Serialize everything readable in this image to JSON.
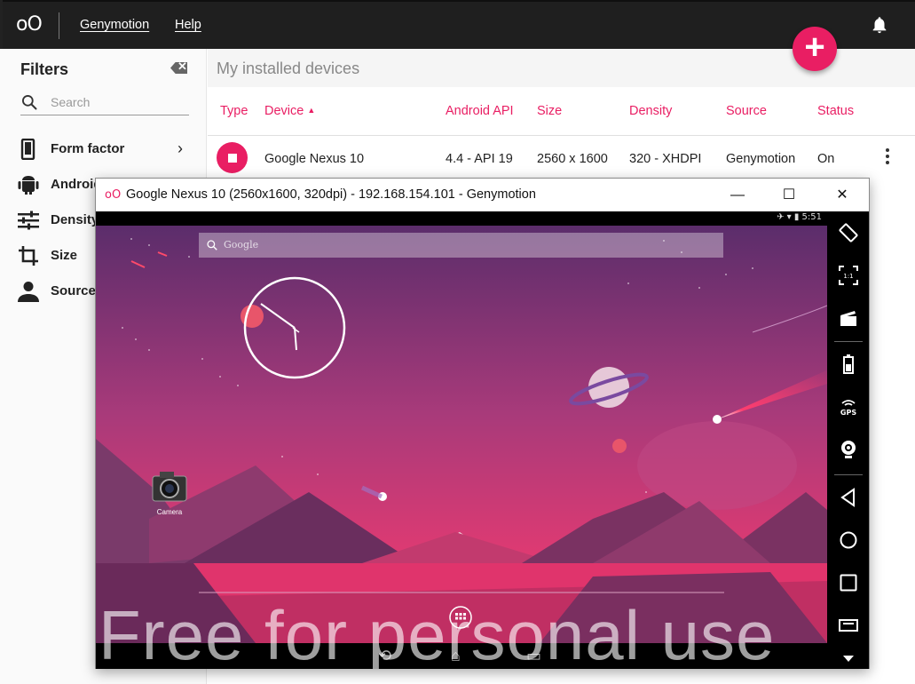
{
  "app": {
    "logo": "oO",
    "menu": [
      "Genymotion",
      "Help"
    ],
    "add_button": "+"
  },
  "sidebar": {
    "title": "Filters",
    "clear_label": "✕",
    "search_placeholder": "Search",
    "items": [
      {
        "label": "Form factor",
        "icon": "phone-icon",
        "has_chevron": true
      },
      {
        "label": "Android API",
        "icon": "android-icon"
      },
      {
        "label": "Density",
        "icon": "sliders-icon"
      },
      {
        "label": "Size",
        "icon": "crop-icon"
      },
      {
        "label": "Source",
        "icon": "person-icon"
      }
    ]
  },
  "main": {
    "title": "My installed devices",
    "columns": [
      "Type",
      "Device",
      "Android API",
      "Size",
      "Density",
      "Source",
      "Status"
    ],
    "sort_indicator": "▲",
    "rows": [
      {
        "device": "Google Nexus 10",
        "api": "4.4 - API 19",
        "size": "2560 x 1600",
        "density": "320 - XHDPI",
        "source": "Genymotion",
        "status": "On"
      }
    ]
  },
  "device_window": {
    "logo": "oO",
    "title": "Google Nexus 10 (2560x1600, 320dpi) - 192.168.154.101 - Genymotion",
    "minimize": "—",
    "maximize": "☐",
    "close": "✕",
    "status_time": "5:51",
    "search_text": "Google",
    "camera_label": "Camera",
    "watermark": "Free for personal use",
    "side_tools": [
      "rotate-icon",
      "scale-icon",
      "screencast-icon",
      "battery-icon",
      "gps-icon",
      "webcam-icon",
      "back-icon",
      "home-icon",
      "recents-icon",
      "menu-icon",
      "more-icon"
    ],
    "gps_label": "GPS",
    "scale_label": "1:1"
  },
  "colors": {
    "accent": "#e91e63",
    "topbar": "#1f1f1f"
  }
}
